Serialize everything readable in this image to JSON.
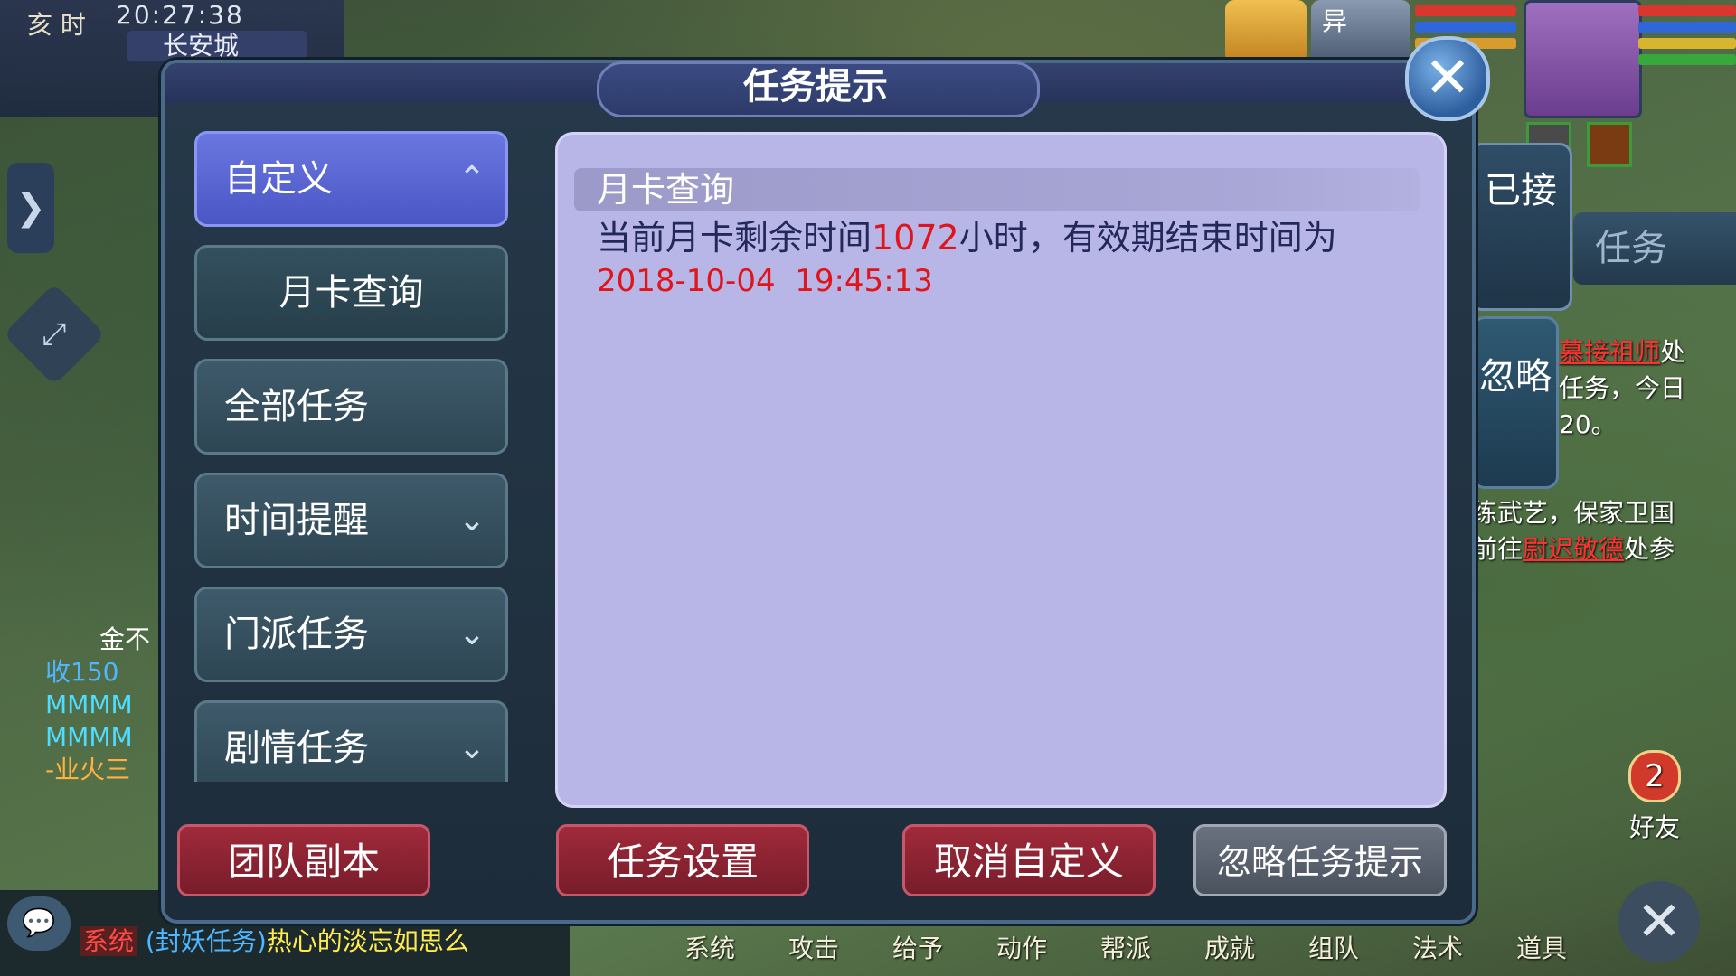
{
  "hud": {
    "hour": "亥 时",
    "time": "20:27:38",
    "city": "长安城",
    "pet2_label": "异",
    "arrow_glyph": "❯",
    "expand_glyph": "⤢"
  },
  "dialog": {
    "title": "任务提示",
    "close_glyph": "✕",
    "categories": [
      {
        "label": "自定义",
        "state": "expanded"
      },
      {
        "label": "月卡查询",
        "state": "sub"
      },
      {
        "label": "全部任务",
        "state": "none"
      },
      {
        "label": "时间提醒",
        "state": "collapsed"
      },
      {
        "label": "门派任务",
        "state": "collapsed"
      },
      {
        "label": "剧情任务",
        "state": "collapsed"
      }
    ],
    "chevron_up": "⌃",
    "chevron_down": "⌄",
    "content": {
      "title": "月卡查询",
      "line1_a": "当前月卡剩余时间",
      "line1_hours": "1072",
      "line1_b": "小时，有效期结束时间为",
      "end_time": "2018-10-04  19:45:13"
    },
    "buttons": {
      "team_dungeon": "团队副本",
      "task_settings": "任务设置",
      "cancel_custom": "取消自定义",
      "ignore_prompt": "忽略任务提示"
    }
  },
  "right_tabs": {
    "taken": "已接",
    "task": "任务",
    "ignore": "忽略"
  },
  "side_text": {
    "line1_link": "慕接祖师",
    "line1_rest": "处",
    "line2": "任务，今日",
    "line3": "20。",
    "line4": "练武艺，保家卫国",
    "line5_a": "前往",
    "line5_link": "尉迟敬德",
    "line5_b": "处参"
  },
  "left_text": {
    "line1": "金不",
    "line2": "收150",
    "line3": "MMMM",
    "line4": "MMMM",
    "line5": "-业火三"
  },
  "chat": {
    "icon_glyph": "💬",
    "sys": "系统",
    "tag": "(封妖任务)",
    "name": "热心的淡忘如思么"
  },
  "bottom_menu": [
    "系统",
    "攻击",
    "给予",
    "动作",
    "帮派",
    "成就",
    "组队",
    "法术",
    "道具"
  ],
  "friends": {
    "label": "好友",
    "count": "2"
  },
  "colors": {
    "accent_red": "#e0151b",
    "panel_lilac": "#b8b6e6",
    "active_tab": "#5a66d4"
  }
}
